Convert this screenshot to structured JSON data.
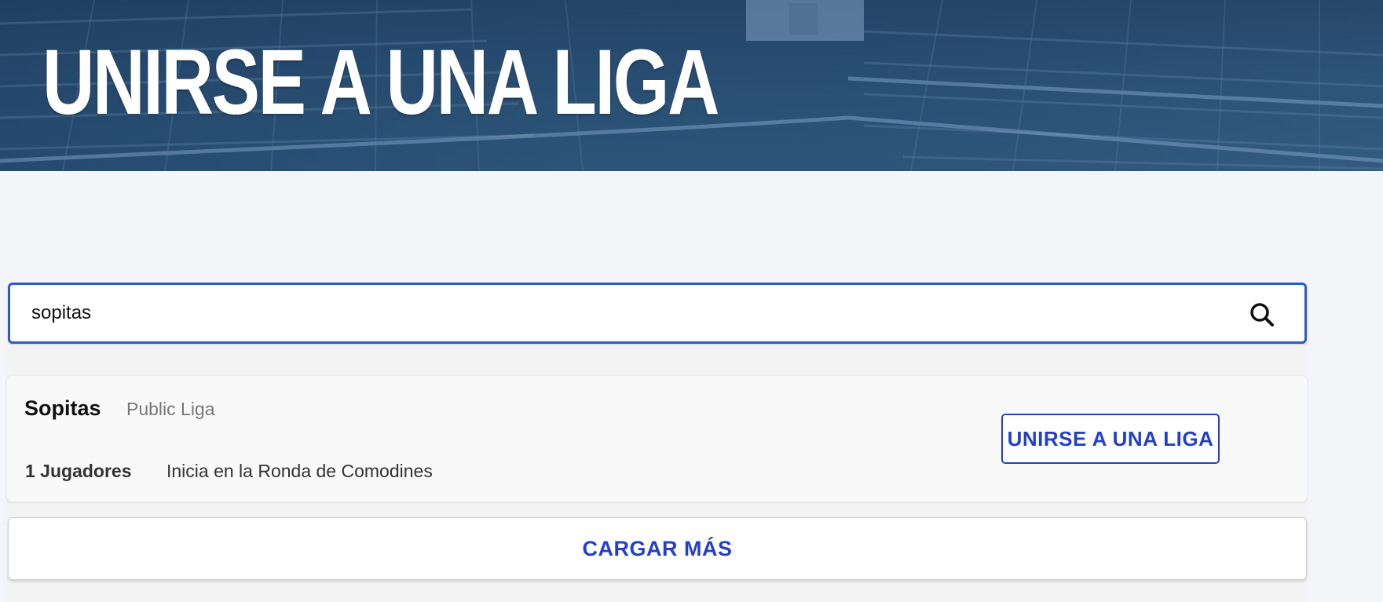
{
  "hero": {
    "title": "UNIRSE A UNA LIGA",
    "background_color": "#2b5277",
    "image_description_icon": "stadium-background"
  },
  "search": {
    "value": "sopitas",
    "placeholder": "",
    "icon": "search-icon",
    "border_color": "#2a5bc8"
  },
  "results": [
    {
      "name": "Sopitas",
      "type": "Public Liga",
      "players": "1 Jugadores",
      "start": "Inicia en la Ronda de Comodines",
      "join_label": "UNIRSE A UNA LIGA"
    }
  ],
  "load_more": {
    "label": "CARGAR MÁS"
  },
  "colors": {
    "accent": "#2440c9",
    "page_background": "#f4f5f8",
    "card_background": "#f9f9f9"
  }
}
